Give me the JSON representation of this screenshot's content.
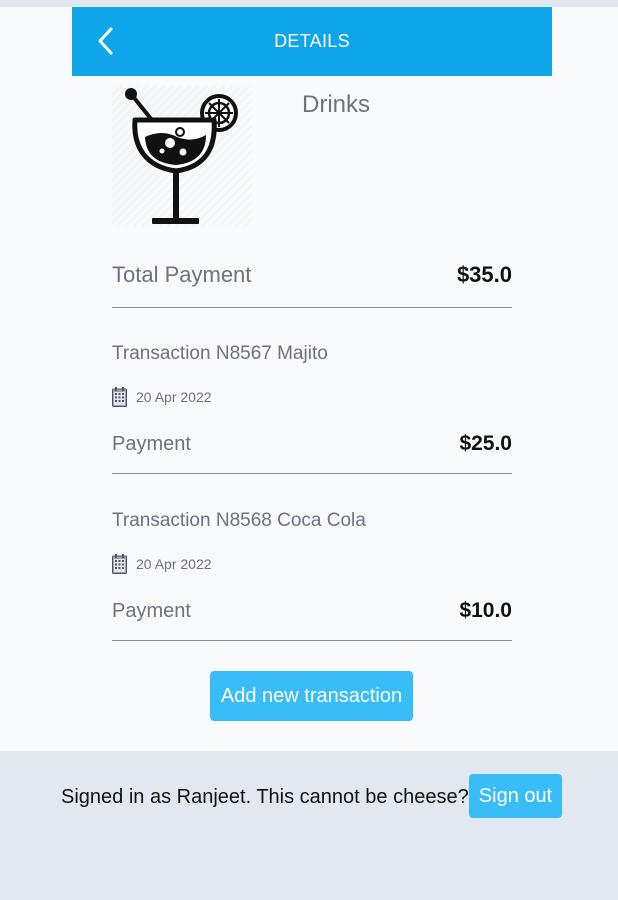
{
  "header": {
    "back_icon": "chevron-left-icon",
    "title": "DETAILS"
  },
  "product": {
    "image_icon": "cocktail-glass-icon",
    "name": "Drinks"
  },
  "total": {
    "label": "Total Payment",
    "amount": "$35.0"
  },
  "transactions": [
    {
      "title": "Transaction N8567 Majito",
      "date": "20 Apr 2022",
      "payment_label": "Payment",
      "amount": "$25.0"
    },
    {
      "title": "Transaction N8568 Coca Cola",
      "date": "20 Apr 2022",
      "payment_label": "Payment",
      "amount": "$10.0"
    }
  ],
  "actions": {
    "add_label": "Add new transaction"
  },
  "footer": {
    "signed_in_text": "Signed in as Ranjeet. This cannot be cheese?",
    "signout_label": "Sign out"
  },
  "colors": {
    "header": "#0ea5e9",
    "button": "#38bdf8",
    "page": "#f8fafc",
    "footer": "#e2e8f0"
  }
}
